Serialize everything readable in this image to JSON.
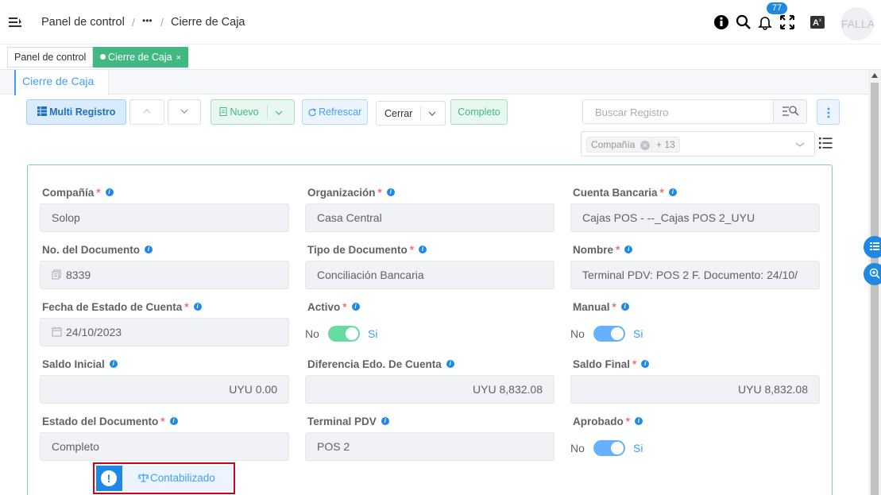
{
  "header": {
    "breadcrumb_home": "Panel de control",
    "breadcrumb_sep": "/",
    "breadcrumb_more": "•••",
    "breadcrumb_current": "Cierre de Caja",
    "notifications_count": "77",
    "avatar_text": "FALLA",
    "icons": [
      "hamburger-icon",
      "info-icon",
      "search-icon",
      "bell-icon",
      "fullscreen-icon",
      "translate-icon"
    ]
  },
  "tags": {
    "home": "Panel de control",
    "active": "Cierre de Caja",
    "close": "×"
  },
  "tab": {
    "label": "Cierre de Caja"
  },
  "toolbar": {
    "multi_registro": "Multi Registro",
    "nuevo": "Nuevo",
    "refrescar": "Refrescar",
    "cerrar": "Cerrar",
    "completo": "Completo",
    "search_placeholder": "Buscar Registro",
    "filter_chip": "Compañía",
    "filter_more": "+ 13"
  },
  "form": {
    "compania": {
      "label": "Compañía",
      "value": "Solop",
      "required": true
    },
    "organizacion": {
      "label": "Organización",
      "value": "Casa Central",
      "required": true
    },
    "cuenta_bancaria": {
      "label": "Cuenta Bancaria",
      "value": "Cajas POS - --_Cajas POS 2_UYU",
      "required": true
    },
    "no_documento": {
      "label": "No. del Documento",
      "value": "8339"
    },
    "tipo_documento": {
      "label": "Tipo de Documento",
      "value": "Conciliación Bancaria",
      "required": true
    },
    "nombre": {
      "label": "Nombre",
      "value": "Terminal PDV: POS 2 F. Documento: 24/10/",
      "required": true
    },
    "fecha_estado": {
      "label": "Fecha de Estado de Cuenta",
      "value": "24/10/2023",
      "required": true
    },
    "activo": {
      "label": "Activo",
      "no": "No",
      "si": "Si",
      "checked": true,
      "required": true
    },
    "manual": {
      "label": "Manual",
      "no": "No",
      "si": "Si",
      "checked": true,
      "required": true
    },
    "saldo_inicial": {
      "label": "Saldo Inicial",
      "value": "UYU 0.00"
    },
    "diferencia": {
      "label": "Diferencia Edo. De Cuenta",
      "value": "UYU 8,832.08"
    },
    "saldo_final": {
      "label": "Saldo Final",
      "value": "UYU 8,832.08",
      "required": true
    },
    "estado_documento": {
      "label": "Estado del Documento",
      "value": "Completo",
      "required": true
    },
    "terminal_pdv": {
      "label": "Terminal PDV",
      "value": "POS 2"
    },
    "aprobado": {
      "label": "Aprobado",
      "no": "No",
      "si": "Si",
      "checked": true,
      "required": true
    }
  },
  "status": {
    "label": "Contabilizado",
    "alert": "!"
  },
  "colors": {
    "primary": "#409eff",
    "success": "#42b983",
    "danger": "#f56c6c",
    "alert_blue": "#1e88e5",
    "switch_green": "#67dba0",
    "switch_blue": "#66b1ff"
  }
}
